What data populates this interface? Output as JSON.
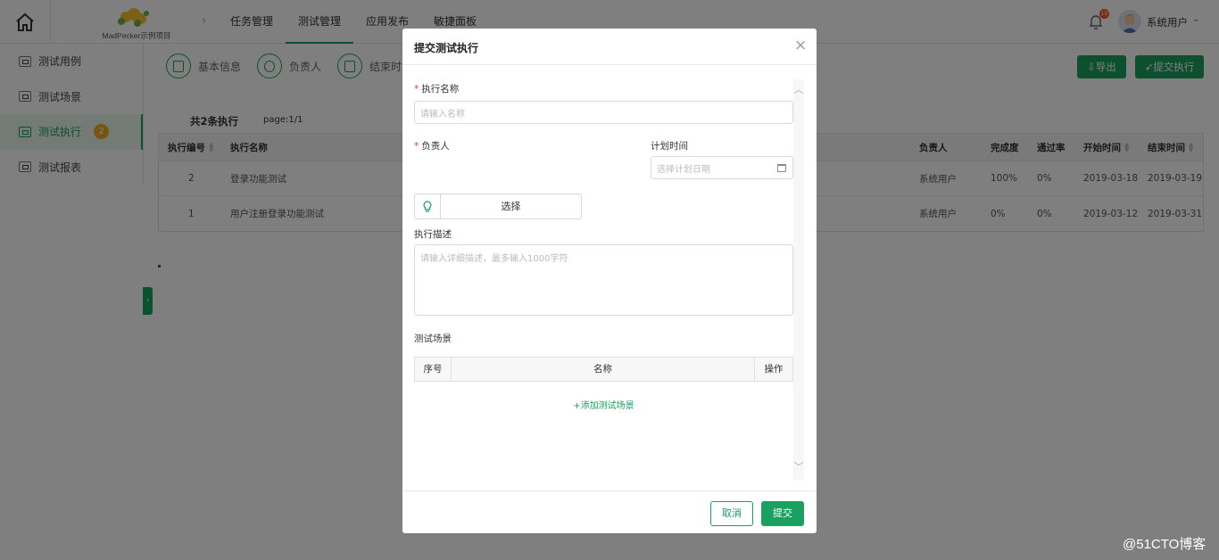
{
  "header": {
    "logo_text": "MadPecker示例项目",
    "nav": [
      "任务管理",
      "测试管理",
      "应用发布",
      "敏捷面板"
    ],
    "active_nav": "测试管理",
    "bell_badge": "10",
    "user_name": "系统用户",
    "user_caret": "⌄"
  },
  "sidebar": {
    "items": [
      {
        "label": "测试用例"
      },
      {
        "label": "测试场景"
      },
      {
        "label": "测试执行",
        "badge": "2"
      },
      {
        "label": "测试报表"
      }
    ],
    "collapse_icon": "‹"
  },
  "main": {
    "steps": [
      "基本信息",
      "负责人",
      "结束时间"
    ],
    "export_label": "⇩导出",
    "submit_exec_label": "➶提交执行",
    "summary": "共2条执行",
    "page_info": "page:1/1",
    "table": {
      "headers": [
        "执行编号",
        "执行名称",
        "负责人",
        "完成度",
        "通过率",
        "开始时间",
        "结束时间"
      ],
      "rows": [
        {
          "id": "2",
          "name": "登录功能测试",
          "owner": "系统用户",
          "progress": "100%",
          "pass_rate": "0%",
          "start": "2019-03-18",
          "end": "2019-03-19"
        },
        {
          "id": "1",
          "name": "用户注册登录功能测试",
          "owner": "系统用户",
          "progress": "0%",
          "pass_rate": "0%",
          "start": "2019-03-12",
          "end": "2019-03-31"
        }
      ]
    }
  },
  "modal": {
    "title": "提交测试执行",
    "close": "×",
    "required_mark": "*",
    "exec_name_label": "执行名称",
    "exec_name_placeholder": "请输入名称",
    "owner_label": "负责人",
    "owner_select": "选择",
    "plan_time_label": "计划时间",
    "plan_time_placeholder": "选择计划日期",
    "desc_label": "执行描述",
    "desc_placeholder": "请输入详细描述，最多输入1000字符",
    "scene_label": "测试场景",
    "scene_columns": [
      "序号",
      "名称",
      "操作"
    ],
    "add_scene": "+添加测试场景",
    "scroll_up": "︿",
    "scroll_down": "﹀",
    "cancel": "取消",
    "submit": "提交"
  },
  "watermark": "@51CTO博客",
  "colors": {
    "accent": "#19a15f",
    "badge": "#f0a81e",
    "required": "#e0451f"
  }
}
